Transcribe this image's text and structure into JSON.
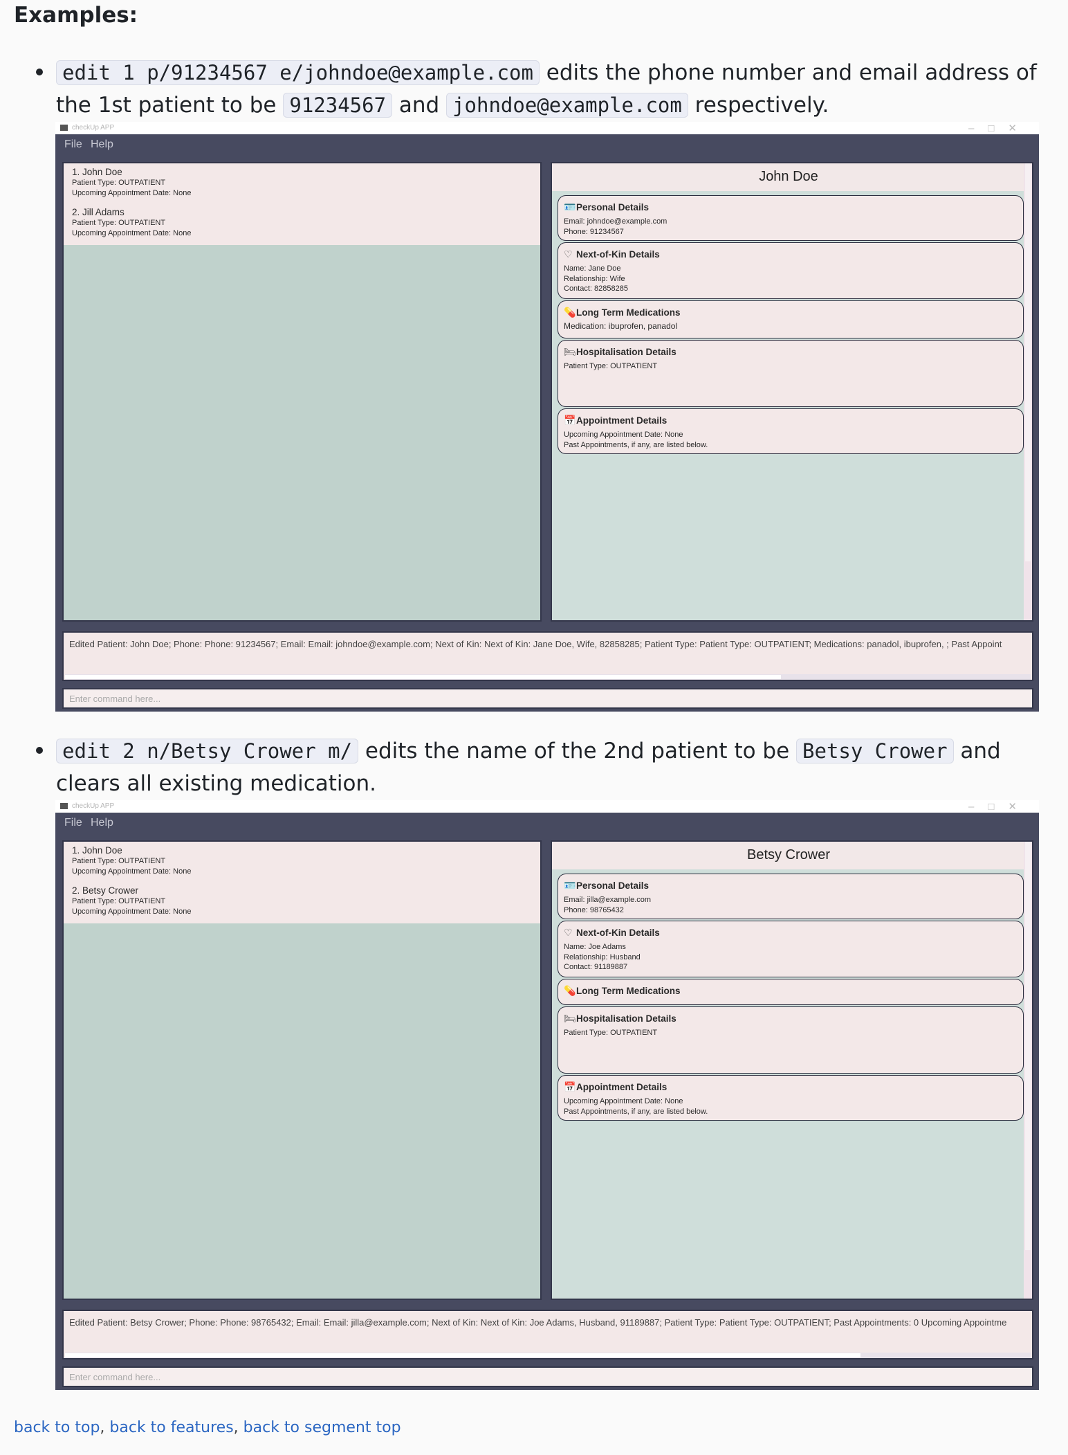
{
  "page": {
    "heading": "Examples:",
    "footer_links": [
      "back to top",
      "back to features",
      "back to segment top"
    ],
    "footer_sep": ", "
  },
  "examples": [
    {
      "desc": {
        "code1": "edit 1 p/91234567 e/johndoe@example.com",
        "t1": " edits the phone number and email address of the 1st patient to be ",
        "code2": "91234567",
        "t2": " and ",
        "code3": "johndoe@example.com",
        "t3": " respectively."
      },
      "app": {
        "title": "checkUp APP",
        "menu": [
          "File",
          "Help"
        ],
        "patients": [
          {
            "name": "1.  John Doe",
            "type": "Patient Type: OUTPATIENT",
            "appt": "Upcoming Appointment Date: None"
          },
          {
            "name": "2.  Jill Adams",
            "type": "Patient Type: OUTPATIENT",
            "appt": "Upcoming Appointment Date: None"
          }
        ],
        "selected_name": "John Doe",
        "sections": {
          "personal": {
            "title": "Personal Details",
            "lines": [
              "Email: johndoe@example.com",
              "Phone: 91234567"
            ]
          },
          "nok": {
            "title": "Next-of-Kin Details",
            "lines": [
              "Name: Jane Doe",
              "Relationship: Wife",
              "Contact: 82858285"
            ]
          },
          "meds": {
            "title": "Long Term Medications",
            "lines": [
              "Medication: ibuprofen, panadol"
            ]
          },
          "hosp": {
            "title": "Hospitalisation Details",
            "lines": [
              "Patient Type: OUTPATIENT"
            ]
          },
          "appt": {
            "title": "Appointment Details",
            "lines": [
              "Upcoming Appointment Date: None",
              "Past Appointments, if any, are listed below."
            ]
          }
        },
        "result": "Edited Patient: John Doe; Phone: Phone: 91234567; Email: Email: johndoe@example.com; Next of Kin: Next of Kin: Jane Doe, Wife, 82858285; Patient Type: Patient Type: OUTPATIENT; Medications: panadol, ibuprofen, ; Past Appoint",
        "command_placeholder": "Enter command here..."
      }
    },
    {
      "desc": {
        "code1": "edit 2 n/Betsy Crower m/",
        "t1": " edits the name of the 2nd patient to be ",
        "code2": "Betsy Crower",
        "t2": " and clears all existing medication."
      },
      "app": {
        "title": "checkUp APP",
        "menu": [
          "File",
          "Help"
        ],
        "patients": [
          {
            "name": "1.  John Doe",
            "type": "Patient Type: OUTPATIENT",
            "appt": "Upcoming Appointment Date: None"
          },
          {
            "name": "2.  Betsy Crower",
            "type": "Patient Type: OUTPATIENT",
            "appt": "Upcoming Appointment Date: None"
          }
        ],
        "selected_name": "Betsy Crower",
        "sections": {
          "personal": {
            "title": "Personal Details",
            "lines": [
              "Email: jilla@example.com",
              "Phone: 98765432"
            ]
          },
          "nok": {
            "title": "Next-of-Kin Details",
            "lines": [
              "Name: Joe Adams",
              "Relationship: Husband",
              "Contact: 91189887"
            ]
          },
          "meds": {
            "title": "Long Term Medications",
            "lines": []
          },
          "hosp": {
            "title": "Hospitalisation Details",
            "lines": [
              "Patient Type: OUTPATIENT"
            ]
          },
          "appt": {
            "title": "Appointment Details",
            "lines": [
              "Upcoming Appointment Date: None",
              "Past Appointments, if any, are listed below."
            ]
          }
        },
        "result": "Edited Patient: Betsy Crower; Phone: Phone: 98765432; Email: Email: jilla@example.com; Next of Kin: Next of Kin: Joe Adams, Husband, 91189887; Patient Type: Patient Type: OUTPATIENT; Past Appointments: 0 Upcoming Appointme",
        "command_placeholder": "Enter command here..."
      }
    }
  ],
  "icons": {
    "personal": "id-card-icon",
    "nok": "heart-hand-icon",
    "meds": "pill-icon",
    "hosp": "hospital-bed-icon",
    "appt": "calendar-icon"
  },
  "colors": {
    "window_frame": "#474a60",
    "panel_left": "#c0d2cc",
    "panel_right": "#cfdeda",
    "card_bg": "#f3e8e8",
    "link": "#2b66c2"
  }
}
